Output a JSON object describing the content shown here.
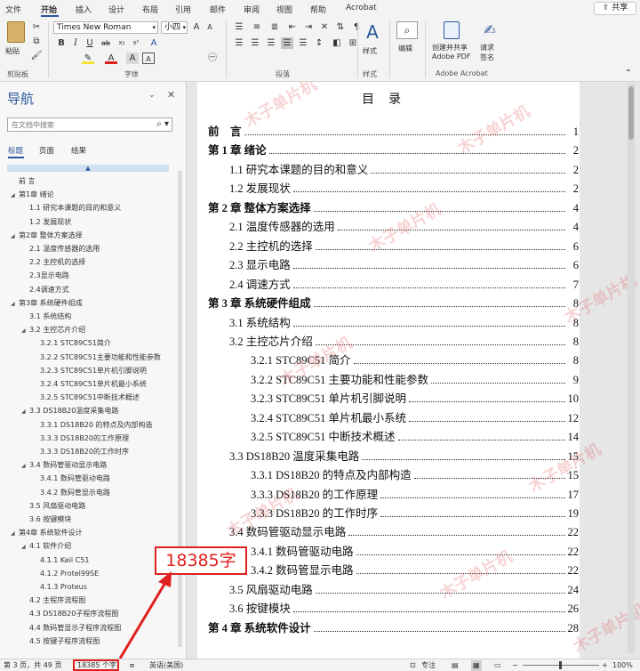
{
  "tabs": [
    "文件",
    "开始",
    "插入",
    "设计",
    "布局",
    "引用",
    "邮件",
    "审阅",
    "视图",
    "帮助",
    "Acrobat"
  ],
  "active_tab": "开始",
  "share_label": "共享",
  "ribbon": {
    "clipboard": {
      "paste": "粘贴",
      "group": "剪贴板"
    },
    "font": {
      "name": "Times New Roman",
      "size": "小四",
      "group": "字体"
    },
    "paragraph": {
      "group": "段落"
    },
    "styles": {
      "label": "样式"
    },
    "editing": {
      "label": "编辑"
    },
    "acrobat": {
      "create": "创建并共享",
      "create2": "Adobe PDF",
      "sign": "请求",
      "sign2": "签名",
      "group": "Adobe Acrobat"
    }
  },
  "nav": {
    "title": "导航",
    "search_placeholder": "在文档中搜索",
    "tabs": [
      "标题",
      "页面",
      "结果"
    ],
    "items": [
      {
        "label": "前 言",
        "level": 0,
        "arrow": false
      },
      {
        "label": "第1章 绪论",
        "level": 0,
        "arrow": true
      },
      {
        "label": "1.1 研究本课题的目的和意义",
        "level": 1,
        "arrow": false
      },
      {
        "label": "1.2 发展现状",
        "level": 1,
        "arrow": false
      },
      {
        "label": "第2章 整体方案选择",
        "level": 0,
        "arrow": true
      },
      {
        "label": "2.1 温度传感器的选用",
        "level": 1,
        "arrow": false
      },
      {
        "label": "2.2 主控机的选择",
        "level": 1,
        "arrow": false
      },
      {
        "label": "2.3显示电路",
        "level": 1,
        "arrow": false
      },
      {
        "label": "2.4调速方式",
        "level": 1,
        "arrow": false
      },
      {
        "label": "第3章 系统硬件组成",
        "level": 0,
        "arrow": true
      },
      {
        "label": "3.1 系统结构",
        "level": 1,
        "arrow": false
      },
      {
        "label": "3.2 主控芯片介绍",
        "level": 1,
        "arrow": true
      },
      {
        "label": "3.2.1 STC89C51简介",
        "level": 2,
        "arrow": false
      },
      {
        "label": "3.2.2 STC89C51主要功能和性能参数",
        "level": 2,
        "arrow": false
      },
      {
        "label": "3.2.3 STC89C51单片机引脚说明",
        "level": 2,
        "arrow": false
      },
      {
        "label": "3.2.4 STC89C51单片机最小系统",
        "level": 2,
        "arrow": false
      },
      {
        "label": "3.2.5 STC89C51中断技术概述",
        "level": 2,
        "arrow": false
      },
      {
        "label": "3.3 DS18B20温度采集电路",
        "level": 1,
        "arrow": true
      },
      {
        "label": "3.3.1 DS18B20 的特点及内部构造",
        "level": 2,
        "arrow": false
      },
      {
        "label": "3.3.3 DS18B20的工作原理",
        "level": 2,
        "arrow": false
      },
      {
        "label": "3.3.3 DS18B20的工作时序",
        "level": 2,
        "arrow": false
      },
      {
        "label": "3.4 数码管驱动显示电路",
        "level": 1,
        "arrow": true
      },
      {
        "label": "3.4.1 数码管驱动电路",
        "level": 2,
        "arrow": false
      },
      {
        "label": "3.4.2 数码管显示电路",
        "level": 2,
        "arrow": false
      },
      {
        "label": "3.5 风扇驱动电路",
        "level": 1,
        "arrow": false
      },
      {
        "label": "3.6 按键模块",
        "level": 1,
        "arrow": false
      },
      {
        "label": "第4章 系统软件设计",
        "level": 0,
        "arrow": true
      },
      {
        "label": "4.1 软件介绍",
        "level": 1,
        "arrow": true
      },
      {
        "label": "4.1.1 Keil C51",
        "level": 2,
        "arrow": false
      },
      {
        "label": "4.1.2 Protel99SE",
        "level": 2,
        "arrow": false
      },
      {
        "label": "4.1.3 Proteus",
        "level": 2,
        "arrow": false
      },
      {
        "label": "4.2 主程序流程图",
        "level": 1,
        "arrow": false
      },
      {
        "label": "4.3 DS18B20子程序流程图",
        "level": 1,
        "arrow": false
      },
      {
        "label": "4.4 数码管显示子程序流程图",
        "level": 1,
        "arrow": false
      },
      {
        "label": "4.5 按键子程序流程图",
        "level": 1,
        "arrow": false
      }
    ]
  },
  "document": {
    "title": "目录",
    "toc": [
      {
        "label": "前　言",
        "page": "1",
        "level": 0,
        "bold": true
      },
      {
        "label": "第 1 章  绪论",
        "page": "2",
        "level": 0,
        "bold": true
      },
      {
        "label": "1.1  研究本课题的目的和意义",
        "page": "2",
        "level": 1,
        "bold": false
      },
      {
        "label": "1.2  发展现状",
        "page": "2",
        "level": 1,
        "bold": false
      },
      {
        "label": "第 2 章  整体方案选择",
        "page": "4",
        "level": 0,
        "bold": true
      },
      {
        "label": "2.1  温度传感器的选用",
        "page": "4",
        "level": 1,
        "bold": false
      },
      {
        "label": "2.2  主控机的选择",
        "page": "6",
        "level": 1,
        "bold": false
      },
      {
        "label": "2.3 显示电路",
        "page": "6",
        "level": 1,
        "bold": false
      },
      {
        "label": "2.4  调速方式",
        "page": "7",
        "level": 1,
        "bold": false
      },
      {
        "label": "第 3 章  系统硬件组成",
        "page": "8",
        "level": 0,
        "bold": true
      },
      {
        "label": "3.1  系统结构",
        "page": "8",
        "level": 1,
        "bold": false
      },
      {
        "label": "3.2  主控芯片介绍",
        "page": "8",
        "level": 1,
        "bold": false
      },
      {
        "label": "3.2.1 STC89C51 简介",
        "page": "8",
        "level": 2,
        "bold": false
      },
      {
        "label": "3.2.2 STC89C51 主要功能和性能参数",
        "page": "9",
        "level": 2,
        "bold": false
      },
      {
        "label": "3.2.3 STC89C51 单片机引脚说明",
        "page": "10",
        "level": 2,
        "bold": false
      },
      {
        "label": "3.2.4 STC89C51 单片机最小系统",
        "page": "12",
        "level": 2,
        "bold": false
      },
      {
        "label": "3.2.5 STC89C51 中断技术概述",
        "page": "14",
        "level": 2,
        "bold": false
      },
      {
        "label": "3.3 DS18B20 温度采集电路",
        "page": "15",
        "level": 1,
        "bold": false
      },
      {
        "label": "3.3.1 DS18B20 的特点及内部构造",
        "page": "15",
        "level": 2,
        "bold": false
      },
      {
        "label": "3.3.3 DS18B20 的工作原理",
        "page": "17",
        "level": 2,
        "bold": false
      },
      {
        "label": "3.3.3 DS18B20 的工作时序",
        "page": "19",
        "level": 2,
        "bold": false
      },
      {
        "label": "3.4  数码管驱动显示电路",
        "page": "22",
        "level": 1,
        "bold": false
      },
      {
        "label": "3.4.1  数码管驱动电路",
        "page": "22",
        "level": 2,
        "bold": false
      },
      {
        "label": "3.4.2  数码管显示电路",
        "page": "22",
        "level": 2,
        "bold": false
      },
      {
        "label": "3.5  风扇驱动电路",
        "page": "24",
        "level": 1,
        "bold": false
      },
      {
        "label": "3.6  按键模块",
        "page": "26",
        "level": 1,
        "bold": false
      },
      {
        "label": "第 4 章  系统软件设计",
        "page": "28",
        "level": 0,
        "bold": true
      }
    ]
  },
  "status": {
    "page": "第 3 页，共 49 页",
    "word_count": "18385 个字",
    "language": "英语(美国)",
    "focus": "专注",
    "zoom": "100%"
  },
  "annotation": {
    "callout": "18385字",
    "color": "#e0201e"
  },
  "watermark": "木子单片机"
}
